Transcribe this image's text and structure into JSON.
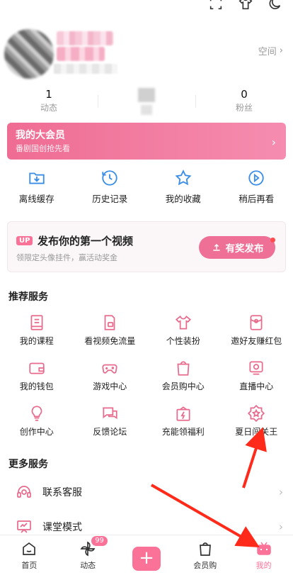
{
  "header": {
    "space_label": "空间"
  },
  "stats": [
    {
      "value": "1",
      "label": "动态"
    },
    {
      "value": "",
      "label": ""
    },
    {
      "value": "0",
      "label": "粉丝"
    }
  ],
  "vip": {
    "title": "我的大会员",
    "subtitle": "番剧国创抢先看"
  },
  "quick": [
    {
      "label": "离线缓存",
      "icon": "download-folder-icon"
    },
    {
      "label": "历史记录",
      "icon": "history-clock-icon"
    },
    {
      "label": "我的收藏",
      "icon": "star-icon"
    },
    {
      "label": "稍后再看",
      "icon": "watch-later-icon"
    }
  ],
  "upload": {
    "tag": "UP",
    "title": "发布你的第一个视频",
    "subtitle": "领限定头像挂件，赢活动奖金",
    "button": "有奖发布"
  },
  "recommend": {
    "title": "推荐服务",
    "items": [
      {
        "label": "我的课程",
        "icon": "course-book-icon"
      },
      {
        "label": "看视频免流量",
        "icon": "sim-card-icon"
      },
      {
        "label": "个性装扮",
        "icon": "tshirt-icon"
      },
      {
        "label": "邀好友赚红包",
        "icon": "red-packet-icon"
      },
      {
        "label": "我的钱包",
        "icon": "wallet-icon"
      },
      {
        "label": "游戏中心",
        "icon": "gamepad-icon"
      },
      {
        "label": "会员购中心",
        "icon": "shopping-bag-icon"
      },
      {
        "label": "直播中心",
        "icon": "live-tv-icon"
      },
      {
        "label": "创作中心",
        "icon": "lightbulb-icon"
      },
      {
        "label": "反馈论坛",
        "icon": "chat-bubbles-icon"
      },
      {
        "label": "充能领福利",
        "icon": "gift-bolt-icon"
      },
      {
        "label": "夏日闯关王",
        "icon": "badge-star-icon"
      }
    ]
  },
  "more": {
    "title": "更多服务",
    "items": [
      {
        "label": "联系客服",
        "icon": "headset-icon"
      },
      {
        "label": "课堂模式",
        "icon": "classroom-icon"
      }
    ]
  },
  "tabbar": {
    "items": [
      {
        "label": "首页",
        "icon": "home-icon"
      },
      {
        "label": "动态",
        "icon": "pinwheel-icon",
        "badge": "99"
      },
      {
        "label": "",
        "icon": "plus-icon"
      },
      {
        "label": "会员购",
        "icon": "shopping-bag-icon"
      },
      {
        "label": "我的",
        "icon": "tv-icon"
      }
    ]
  },
  "colors": {
    "accent": "#fb7299",
    "icon_blue": "#3a8ee6",
    "annotation_red": "#ff2a1a"
  }
}
